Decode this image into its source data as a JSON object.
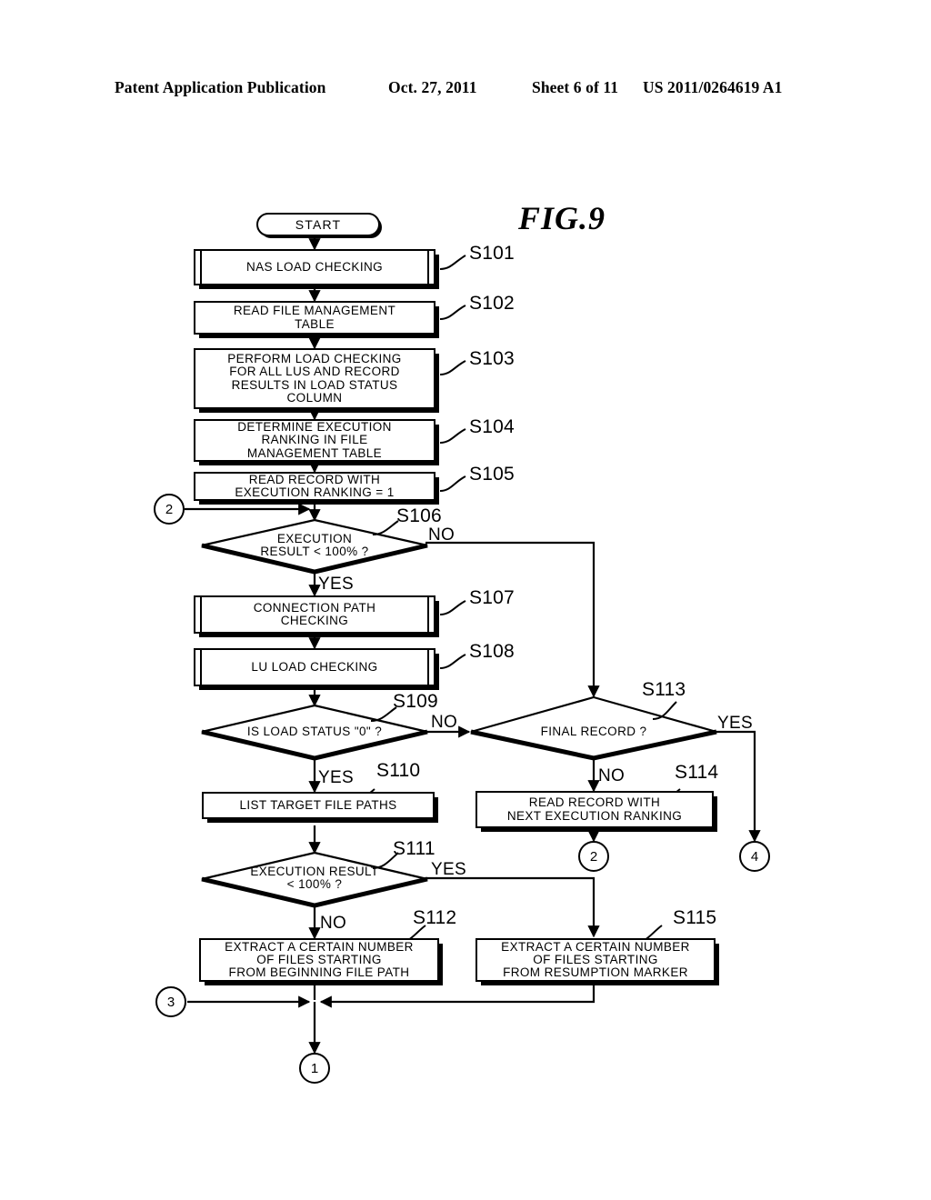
{
  "header": {
    "publication": "Patent Application Publication",
    "date": "Oct. 27, 2011",
    "sheet": "Sheet 6 of 11",
    "patent_number": "US 2011/0264619 A1"
  },
  "figure": {
    "title": "FIG.9"
  },
  "flowchart": {
    "start": {
      "label": "START"
    },
    "nodes": [
      {
        "id": "S101",
        "step": "S101",
        "shape": "predefined-process",
        "text": "NAS  LOAD  CHECKING"
      },
      {
        "id": "S102",
        "step": "S102",
        "shape": "process",
        "text": "READ FILE MANAGEMENT\nTABLE"
      },
      {
        "id": "S103",
        "step": "S103",
        "shape": "process",
        "text": "PERFORM LOAD CHECKING\nFOR ALL LUS AND RECORD\nRESULTS IN LOAD STATUS\nCOLUMN"
      },
      {
        "id": "S104",
        "step": "S104",
        "shape": "process",
        "text": "DETERMINE EXECUTION\nRANKING IN FILE\nMANAGEMENT TABLE"
      },
      {
        "id": "S105",
        "step": "S105",
        "shape": "process",
        "text": "READ  RECORD  WITH\nEXECUTION  RANKING = 1"
      },
      {
        "id": "S106",
        "step": "S106",
        "shape": "decision",
        "text": "EXECUTION\nRESULT < 100% ?"
      },
      {
        "id": "S107",
        "step": "S107",
        "shape": "predefined-process",
        "text": "CONNECTION  PATH\nCHECKING"
      },
      {
        "id": "S108",
        "step": "S108",
        "shape": "predefined-process",
        "text": "LU  LOAD  CHECKING"
      },
      {
        "id": "S109",
        "step": "S109",
        "shape": "decision",
        "text": "IS  LOAD  STATUS \"0\" ?"
      },
      {
        "id": "S110",
        "step": "S110",
        "shape": "process",
        "text": "LIST  TARGET  FILE  PATHS"
      },
      {
        "id": "S111",
        "step": "S111",
        "shape": "decision",
        "text": "EXECUTION  RESULT\n< 100% ?"
      },
      {
        "id": "S112",
        "step": "S112",
        "shape": "process",
        "text": "EXTRACT A CERTAIN NUMBER\nOF FILES STARTING\nFROM BEGINNING FILE PATH"
      },
      {
        "id": "S113",
        "step": "S113",
        "shape": "decision",
        "text": "FINAL  RECORD ?"
      },
      {
        "id": "S114",
        "step": "S114",
        "shape": "process",
        "text": "READ  RECORD  WITH\nNEXT EXECUTION  RANKING"
      },
      {
        "id": "S115",
        "step": "S115",
        "shape": "process",
        "text": "EXTRACT A CERTAIN NUMBER\nOF FILES STARTING\nFROM RESUMPTION MARKER"
      }
    ],
    "connectors": [
      {
        "id": "c2-left",
        "label": "2"
      },
      {
        "id": "c2-bottom",
        "label": "2"
      },
      {
        "id": "c4",
        "label": "4"
      },
      {
        "id": "c3",
        "label": "3"
      },
      {
        "id": "c1",
        "label": "1"
      }
    ],
    "edge_labels": [
      {
        "id": "s106-no",
        "label": "NO"
      },
      {
        "id": "s106-yes",
        "label": "YES"
      },
      {
        "id": "s109-no",
        "label": "NO"
      },
      {
        "id": "s109-yes",
        "label": "YES"
      },
      {
        "id": "s111-yes",
        "label": "YES"
      },
      {
        "id": "s111-no",
        "label": "NO"
      },
      {
        "id": "s113-yes",
        "label": "YES"
      },
      {
        "id": "s113-no",
        "label": "NO"
      }
    ]
  }
}
